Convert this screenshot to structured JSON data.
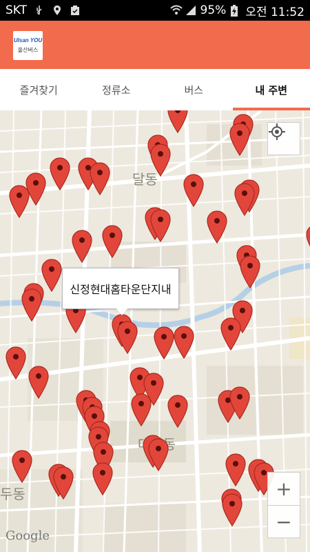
{
  "status_bar": {
    "carrier": "SKT",
    "battery": "95%",
    "time": "오전 11:52"
  },
  "header": {
    "logo_mark": "Ulsan YOU",
    "logo_text": "울산버스"
  },
  "tabs": [
    {
      "label": "즐겨찾기",
      "active": false
    },
    {
      "label": "정류소",
      "active": false
    },
    {
      "label": "버스",
      "active": false
    },
    {
      "label": "내 주변",
      "active": true
    }
  ],
  "map": {
    "labels": [
      "달동",
      "대현동",
      "두동"
    ],
    "info_window": "신정현대홈타운단지내",
    "marker_color": "#e2463a",
    "google": "Google",
    "zoom_in": "+",
    "zoom_out": "−"
  }
}
